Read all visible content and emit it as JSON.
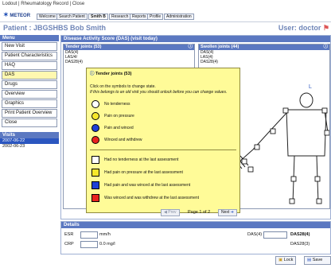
{
  "topbar": {
    "text": "Lodout | Rheumatology Record | Close"
  },
  "toolbar": {
    "logo": "METEOR",
    "tabs": [
      {
        "label": "Welcome",
        "active": false
      },
      {
        "label": "Search Patient",
        "active": false
      },
      {
        "label": "Smith B",
        "active": true
      },
      {
        "label": "Research",
        "active": false
      },
      {
        "label": "Reports",
        "active": false
      },
      {
        "label": "Profile",
        "active": false
      },
      {
        "label": "Administration",
        "active": false
      }
    ]
  },
  "patient": {
    "label": "Patient : JBGSHBS Bob Smith"
  },
  "user": {
    "label": "User: doctor"
  },
  "menu": {
    "header": "Menu",
    "items": [
      {
        "label": "New Visit",
        "selected": false
      },
      {
        "label": "Patient Characteristics",
        "selected": false
      },
      {
        "label": "HAQ",
        "selected": false
      },
      {
        "label": "DAS",
        "selected": true
      },
      {
        "label": "Drugs",
        "selected": false
      },
      {
        "label": "Overview",
        "selected": false
      },
      {
        "label": "Graphics",
        "selected": false
      },
      {
        "label": "Print Patient Overview",
        "selected": false
      },
      {
        "label": "Close",
        "selected": false
      }
    ]
  },
  "visits": {
    "header": "Visits",
    "items": [
      {
        "label": "2007-06-22",
        "selected": true
      },
      {
        "label": "2002-06-23",
        "selected": false
      }
    ]
  },
  "das": {
    "header": "Disease Activity Score (DAS) (visit today)",
    "tender": {
      "title": "Tender joints (53)",
      "rows": [
        "DAS(4)",
        "LAS/4/",
        "DAS28(4)"
      ]
    },
    "swollen": {
      "title": "Swollen joints (44)",
      "rows": [
        "DAS(4)",
        "LAS(4)",
        "DAS28(4)"
      ],
      "side_label": "L"
    }
  },
  "popup": {
    "title": "Tender joints (53)",
    "line1": "Click on the symbols to change state.",
    "line2": "If this belongs to an old visit you should unlock before you can change values.",
    "legend_current": [
      {
        "shape": "circle",
        "color": "#ffffff",
        "label": "No tenderness"
      },
      {
        "shape": "circle",
        "color": "#f7e82a",
        "label": "Pain on pressure"
      },
      {
        "shape": "circle",
        "color": "#1e3fd6",
        "label": "Pain and winced"
      },
      {
        "shape": "circle",
        "color": "#e8231f",
        "label": "Winced and withdrew"
      }
    ],
    "legend_change": [
      {
        "shape": "square",
        "color": "#ffffff",
        "label": "Had no tenderness at the last assessment"
      },
      {
        "shape": "square",
        "color": "#f7e82a",
        "label": "Had pain on pressure at the last assessment"
      },
      {
        "shape": "square",
        "color": "#1e3fd6",
        "label": "Had pain and was winced at the last assessment"
      },
      {
        "shape": "square",
        "color": "#e8231f",
        "label": "Was winced and was withdrew at the last assessment"
      }
    ]
  },
  "pager": {
    "prev": "Prev",
    "page": "Page 1 of 2",
    "next": "Next"
  },
  "details": {
    "header": "Details",
    "esr_label": "ESR",
    "esr_unit": "mm/h",
    "crp_label": "CRP",
    "crp_unit": "0.0 mg/l",
    "das4_label": "DAS(4)",
    "das28_label": "DAS28(4)",
    "das28_4_label": "DAS28(3)"
  },
  "buttons": {
    "lock": "Lock",
    "save": "Save"
  },
  "colors": {
    "header_blue": "#5b78c1",
    "popup_yellow": "#fffb98",
    "visit_selected": "#2b56c0"
  }
}
